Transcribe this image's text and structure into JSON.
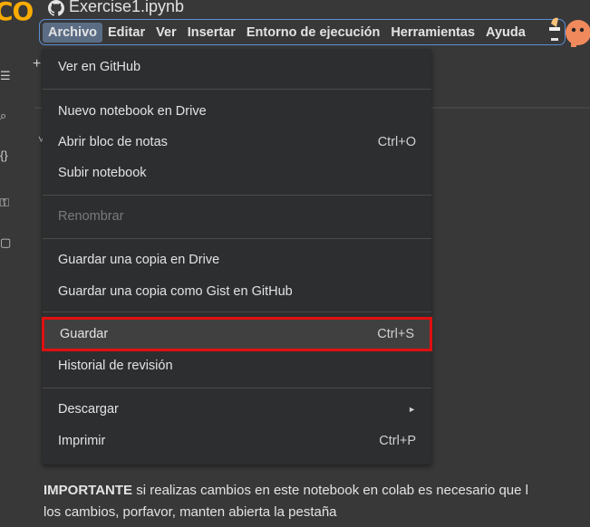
{
  "header": {
    "logo_text": "CO",
    "notebook_title": "Exercise1.ipynb"
  },
  "menubar": {
    "items": [
      "Archivo",
      "Editar",
      "Ver",
      "Insertar",
      "Entorno de ejecución",
      "Herramientas",
      "Ayuda"
    ],
    "active_index": 0
  },
  "toolbar": {
    "plus_label": "+"
  },
  "file_menu": {
    "items": [
      {
        "label": "Ver en GitHub",
        "shortcut": ""
      },
      {
        "label": "Nuevo notebook en Drive",
        "shortcut": ""
      },
      {
        "label": "Abrir bloc de notas",
        "shortcut": "Ctrl+O"
      },
      {
        "label": "Subir notebook",
        "shortcut": ""
      },
      {
        "label": "Renombrar",
        "shortcut": "",
        "disabled": true
      },
      {
        "label": "Guardar una copia en Drive",
        "shortcut": ""
      },
      {
        "label": "Guardar una copia como Gist en GitHub",
        "shortcut": ""
      },
      {
        "label": "Guardar",
        "shortcut": "Ctrl+S",
        "highlighted": true
      },
      {
        "label": "Historial de revisión",
        "shortcut": ""
      },
      {
        "label": "Descargar",
        "shortcut": "►"
      },
      {
        "label": "Imprimir",
        "shortcut": "Ctrl+P"
      }
    ]
  },
  "notebook": {
    "important_bold": "IMPORTANTE",
    "important_line1": " si realizas cambios en este notebook en colab es necesario que l",
    "important_line2": "los cambios, porfavor, manten abierta la pestaña"
  },
  "colors": {
    "background": "#383838",
    "menu_background": "#2d2e30",
    "menubar_outline": "#5a8fd9",
    "highlight_outline": "#e01010",
    "logo": "#f9ab00"
  }
}
